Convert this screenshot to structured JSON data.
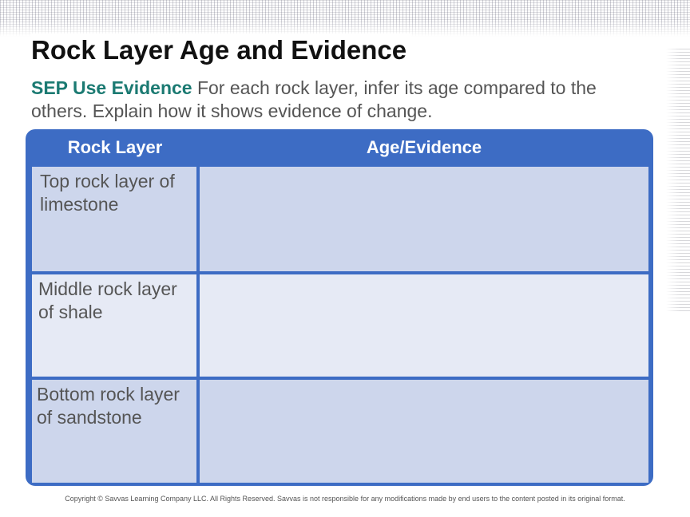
{
  "title": "Rock Layer Age and Evidence",
  "instructions": {
    "label": "SEP Use Evidence",
    "text": " For each rock layer, infer its age compared to the others. Explain how it shows evidence of change."
  },
  "table": {
    "headers": [
      "Rock Layer",
      "Age/Evidence"
    ],
    "rows": [
      {
        "layer": "Top rock layer of limestone",
        "evidence": ""
      },
      {
        "layer": "Middle rock layer of shale",
        "evidence": ""
      },
      {
        "layer": "Bottom rock layer of sandstone",
        "evidence": ""
      }
    ]
  },
  "footer": "Copyright © Savvas Learning Company LLC. All Rights Reserved. Savvas is not responsible for any modifications made by end users to the content posted in its original format.",
  "colors": {
    "header_blue": "#3d6cc4",
    "row_light": "#e6eaf5",
    "row_dark": "#cdd6ec",
    "sep_label": "#1b7a72"
  }
}
